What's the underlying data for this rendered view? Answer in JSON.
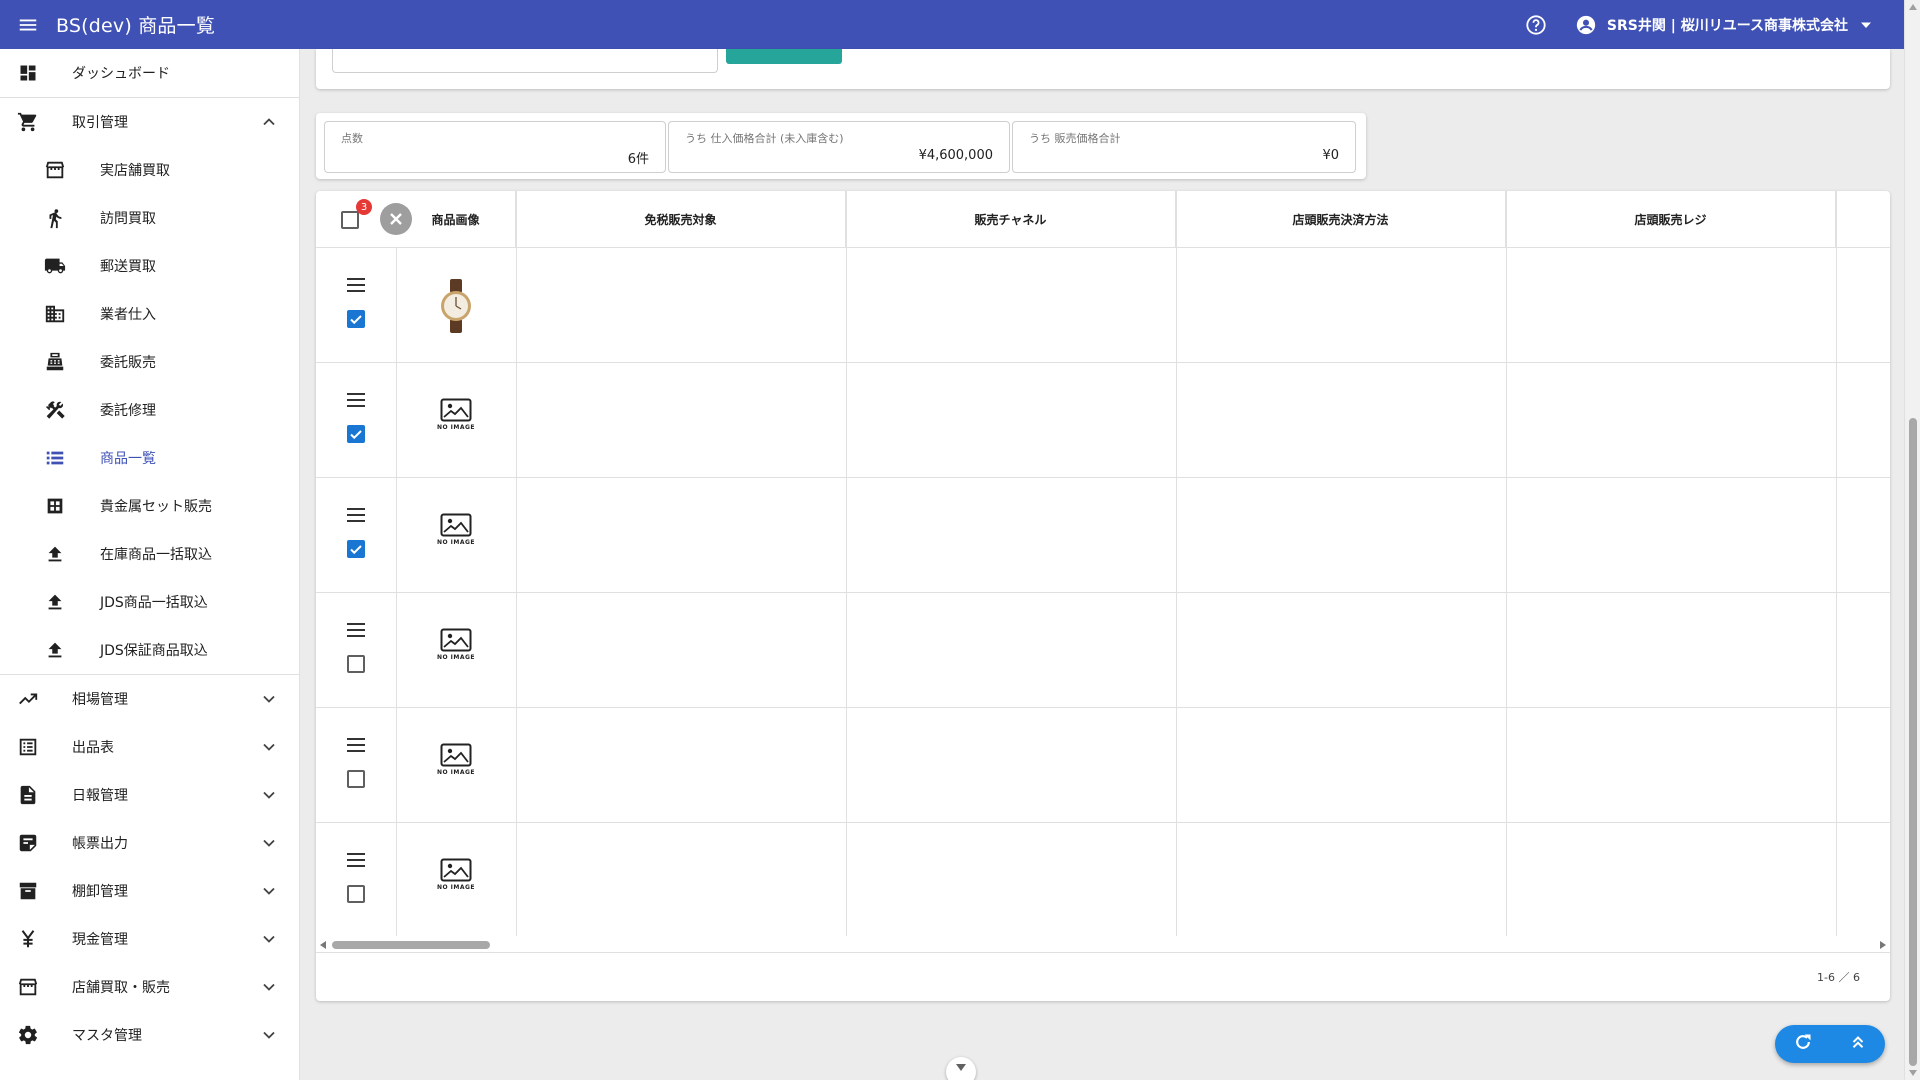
{
  "appbar": {
    "title": "BS(dev) 商品一覧",
    "user_label": "SRS井関 | 桜川リユース商事株式会社",
    "color": "#3f51b5"
  },
  "sidebar": {
    "items": [
      {
        "label": "ダッシュボード",
        "icon": "dashboard-icon"
      },
      {
        "label": "取引管理",
        "icon": "cart-icon",
        "expanded": true
      },
      {
        "label": "実店舗買取",
        "icon": "storefront-icon"
      },
      {
        "label": "訪問買取",
        "icon": "walk-icon"
      },
      {
        "label": "郵送買取",
        "icon": "truck-icon"
      },
      {
        "label": "業者仕入",
        "icon": "building-icon"
      },
      {
        "label": "委託販売",
        "icon": "register-icon"
      },
      {
        "label": "委託修理",
        "icon": "tools-icon"
      },
      {
        "label": "商品一覧",
        "icon": "list-icon",
        "active": true
      },
      {
        "label": "貴金属セット販売",
        "icon": "grid-icon"
      },
      {
        "label": "在庫商品一括取込",
        "icon": "upload-icon"
      },
      {
        "label": "JDS商品一括取込",
        "icon": "upload-icon"
      },
      {
        "label": "JDS保証商品取込",
        "icon": "upload-icon"
      },
      {
        "label": "相場管理",
        "icon": "trend-icon"
      },
      {
        "label": "出品表",
        "icon": "listalt-icon"
      },
      {
        "label": "日報管理",
        "icon": "document-icon"
      },
      {
        "label": "帳票出力",
        "icon": "note-icon"
      },
      {
        "label": "棚卸管理",
        "icon": "archive-icon"
      },
      {
        "label": "現金管理",
        "icon": "yen-icon"
      },
      {
        "label": "店舗買取・販売",
        "icon": "store-icon"
      },
      {
        "label": "マスタ管理",
        "icon": "gear-icon"
      }
    ],
    "active_color": "#3f51b5"
  },
  "summary": {
    "count_label": "点数",
    "count_value": "6件",
    "purchase_label": "うち 仕入価格合計 (未入庫含む)",
    "purchase_value": "¥4,600,000",
    "sales_label": "うち 販売価格合計",
    "sales_value": "¥0"
  },
  "table": {
    "selected_badge": "3",
    "headers": [
      "商品画像",
      "免税販売対象",
      "販売チャネル",
      "店頭販売決済方法",
      "店頭販売レジ"
    ],
    "rows": [
      {
        "checked": true,
        "image": "watch"
      },
      {
        "checked": true,
        "image": "NO IMAGE"
      },
      {
        "checked": true,
        "image": "NO IMAGE"
      },
      {
        "checked": false,
        "image": "NO IMAGE"
      },
      {
        "checked": false,
        "image": "NO IMAGE"
      },
      {
        "checked": false,
        "image": "NO IMAGE"
      }
    ],
    "pagination": "1-6 ／ 6",
    "check_color": "#1976d2"
  },
  "fab": {
    "color": "#1e88e5"
  }
}
